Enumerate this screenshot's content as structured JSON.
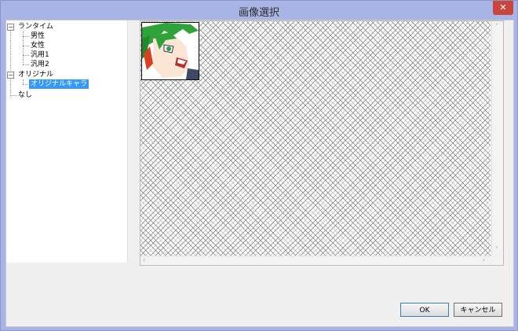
{
  "window": {
    "title": "画像選択",
    "close_symbol": "✕"
  },
  "tree": {
    "random": {
      "label": "ランタイム",
      "expander": "−"
    },
    "random_children": [
      "男性",
      "女性",
      "汎用1",
      "汎用2"
    ],
    "original": {
      "label": "オリジナル",
      "expander": "−"
    },
    "original_children": [
      "オリジナルキャラ"
    ],
    "none": "なし"
  },
  "preview": {
    "thumbnail_icon": "character-portrait-icon"
  },
  "scrollbar": {
    "up": "˄",
    "down": "˅",
    "left": "‹",
    "right": "›"
  },
  "buttons": {
    "ok": "OK",
    "cancel": "キャンセル"
  },
  "colors": {
    "title_bar": "#a9b4e6",
    "selection": "#3399ff",
    "close_button": "#c9463d"
  }
}
